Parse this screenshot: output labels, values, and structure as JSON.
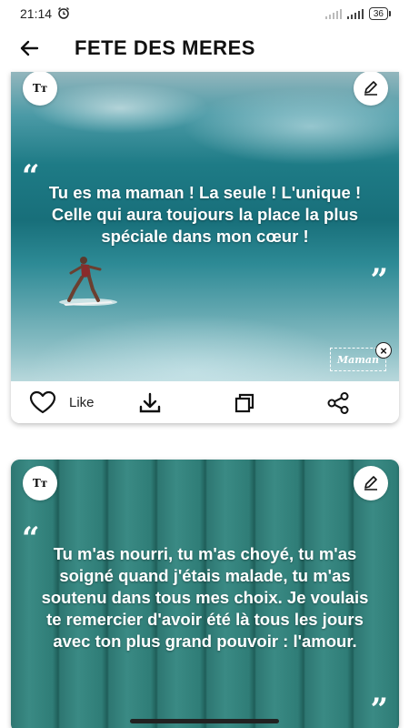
{
  "status_bar": {
    "time": "21:14",
    "battery": "36"
  },
  "header": {
    "title": "FETE DES MERES"
  },
  "cards": [
    {
      "font_button": "Tт",
      "quote_open": "“",
      "quote_close": "”",
      "text": "Tu es ma maman ! La seule ! L'unique ! Celle qui aura toujours la place la plus spéciale dans mon cœur !",
      "watermark": "Maman",
      "like_label": "Like"
    },
    {
      "font_button": "Tт",
      "quote_open": "“",
      "quote_close": "”",
      "text": "Tu m'as nourri, tu m'as choyé, tu m'as soigné quand j'étais malade, tu m'as soutenu dans tous mes choix. Je voulais te remercier d'avoir été là tous les jours avec ton plus grand pouvoir : l'amour."
    }
  ],
  "icons": [
    "back-arrow-icon",
    "alarm-clock-icon",
    "signal-icon",
    "battery-icon",
    "edit-pen-icon",
    "heart-icon",
    "download-icon",
    "copy-icon",
    "share-icon",
    "close-icon"
  ]
}
